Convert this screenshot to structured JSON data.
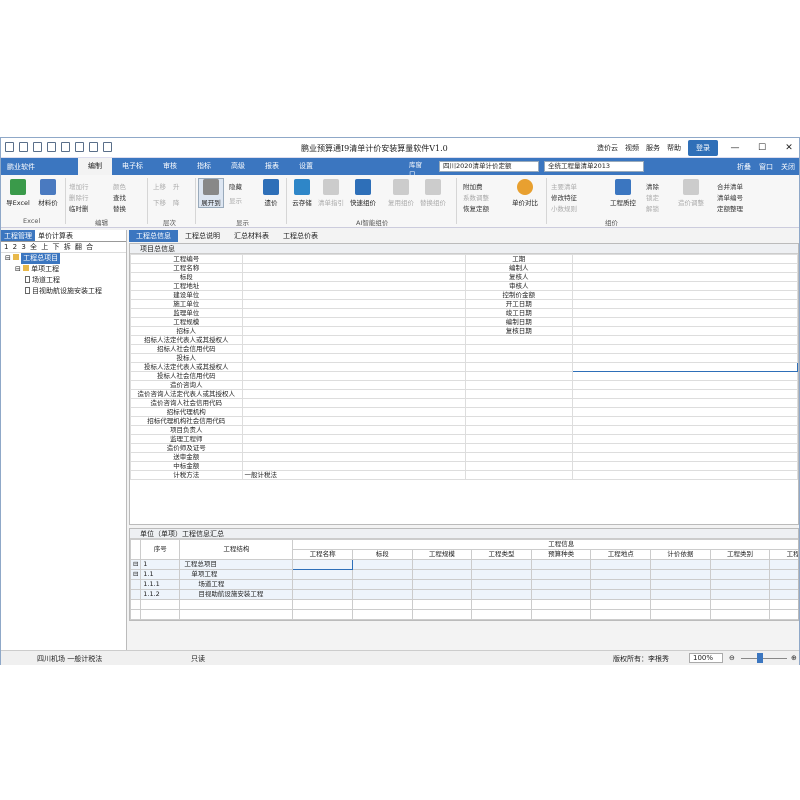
{
  "title": "鹏业预算通I9清单计价安装算量软件V1.0",
  "title_right": {
    "cloud": "造价云",
    "video": "视频",
    "service": "服务",
    "help": "帮助",
    "login": "登录"
  },
  "menubar": {
    "logo": "鹏业软件",
    "items": [
      "编制",
      "电子标",
      "审核",
      "指标",
      "高级",
      "报表",
      "设置"
    ],
    "active": "编制",
    "lib": "库窗口",
    "sel1": "四川2020清单计价定额",
    "sel2": "全统工程量清单2013",
    "fold": "折叠",
    "window": "窗口",
    "close": "关闭"
  },
  "ribbon": {
    "excel": {
      "export": "导Excel",
      "material": "材料价",
      "group": "Excel"
    },
    "edit": [
      "增加行",
      "删除行",
      "临时删",
      "颜色",
      "查找",
      "替换"
    ],
    "edit_group": "编辑",
    "level": [
      "上移",
      "升",
      "下移",
      "降"
    ],
    "level_group": "层次",
    "display": {
      "expand": "展开到",
      "hide": "隐藏",
      "show": "显示",
      "price": "遗价"
    },
    "display_group": "显示",
    "ai": {
      "save": "云存储",
      "clear": "清单指引",
      "fast": "快速组价",
      "reuse": "复用组价",
      "replace": "替换组价"
    },
    "ai_group": "AI智能组价",
    "fee": {
      "add": "附加费",
      "adjust": "系数调整",
      "restore": "恢复定额",
      "compare": "单价对比"
    },
    "price": {
      "main": "主要清单",
      "modify": "修改特征",
      "small": "小数规则",
      "check": "工程质控",
      "clean": "清除",
      "lock": "锁定",
      "unlock": "解锁",
      "adjust": "造价调整",
      "merge": "合并清单",
      "code": "清单编号",
      "quota": "定额整理"
    },
    "price_group": "组价"
  },
  "left": {
    "tabs": [
      "工程管理",
      "单价计算表"
    ],
    "levels": "1 2 3 全 上 下 拆 翻 合",
    "tree": [
      {
        "label": "工程总项目",
        "indent": 0
      },
      {
        "label": "单项工程",
        "indent": 1
      },
      {
        "label": "场道工程",
        "indent": 2
      },
      {
        "label": "目视助航设施安装工程",
        "indent": 2
      }
    ]
  },
  "tabs": [
    "工程总信息",
    "工程总说明",
    "汇总材料表",
    "工程总价表"
  ],
  "info": {
    "title": "项目总信息",
    "left": [
      "工程编号",
      "工程名称",
      "标段",
      "工程地址",
      "建设单位",
      "施工单位",
      "监理单位",
      "工程规模",
      "招标人",
      "招标人法定代表人或其授权人",
      "招标人社会信用代码",
      "投标人",
      "投标人法定代表人或其授权人",
      "投标人社会信用代码",
      "造价咨询人",
      "造价咨询人法定代表人或其授权人",
      "造价咨询人社会信用代码",
      "招标代理机构",
      "招标代理机构社会信用代码",
      "项目负责人",
      "监理工程师",
      "造价师及证号",
      "送审金额",
      "中标金额",
      "计税方法"
    ],
    "right": [
      "工期",
      "编制人",
      "复核人",
      "审核人",
      "控制价金额",
      "开工日期",
      "竣工日期",
      "编制日期",
      "复核日期"
    ],
    "tax_value": "一般计税法"
  },
  "grid": {
    "title": "单位（单项）工程信息汇总",
    "h_no": "序号",
    "h_struct": "工程结构",
    "h_info": "工程信息",
    "cols": [
      "工程名称",
      "标段",
      "工程规模",
      "工程类型",
      "预算种类",
      "工程地点",
      "计价依据",
      "工程类别",
      "工程结构"
    ],
    "rows": [
      {
        "no": "1",
        "name": "工程总项目",
        "pad": 0,
        "fold": "⊟"
      },
      {
        "no": "1.1",
        "name": "单项工程",
        "pad": 1,
        "fold": "⊟"
      },
      {
        "no": "1.1.1",
        "name": "场道工程",
        "pad": 2,
        "fold": ""
      },
      {
        "no": "1.1.2",
        "name": "目视助航设施安装工程",
        "pad": 2,
        "fold": ""
      }
    ]
  },
  "status": {
    "left": "四川机场  一般计税法",
    "mode": "只读",
    "copyright": "版权所有：李根秀",
    "zoom": "100%"
  }
}
